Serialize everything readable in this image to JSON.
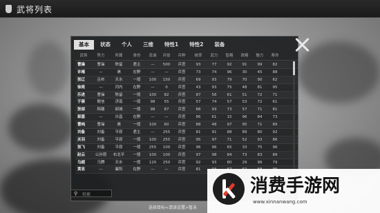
{
  "header": {
    "title": "武将列表"
  },
  "tabs": [
    {
      "label": "基本",
      "active": true
    },
    {
      "label": "状态"
    },
    {
      "label": "个人"
    },
    {
      "label": "三维"
    },
    {
      "label": "特性1"
    },
    {
      "label": "特性2"
    },
    {
      "label": "装备"
    }
  ],
  "columns": [
    "武将",
    "势力",
    "所属",
    "身份",
    "忠诚",
    "兵役",
    "兵种",
    "统率",
    "武力",
    "智略",
    "政略",
    "魅力",
    "寿命"
  ],
  "rows": [
    [
      "曹操",
      "曹操",
      "陈留",
      "君主",
      "—",
      "500",
      "兵官",
      "93",
      "77",
      "92",
      "91",
      "99",
      "82"
    ],
    [
      "许褚",
      "—",
      "谯",
      "在野",
      "—",
      "—",
      "兵官",
      "73",
      "74",
      "96",
      "30",
      "45",
      "88"
    ],
    [
      "张辽",
      "吕布",
      "天水",
      "一般",
      "100",
      "150",
      "兵官",
      "69",
      "93",
      "79",
      "70",
      "90",
      "62"
    ],
    [
      "徐晃",
      "—",
      "河内",
      "在野",
      "—",
      "0",
      "兵官",
      "43",
      "93",
      "75",
      "48",
      "81",
      "95"
    ],
    [
      "乐进",
      "曹操",
      "陈留",
      "一般",
      "100",
      "82",
      "兵官",
      "87",
      "56",
      "61",
      "51",
      "72",
      "71"
    ],
    [
      "于禁",
      "鲍信",
      "济南",
      "一般",
      "98",
      "55",
      "兵官",
      "57",
      "74",
      "57",
      "53",
      "72",
      "61"
    ],
    [
      "张郃",
      "韩馥",
      "邺城",
      "一般",
      "98",
      "87",
      "兵官",
      "88",
      "93",
      "73",
      "57",
      "71",
      "81"
    ],
    [
      "郭嘉",
      "—",
      "许昌",
      "在野",
      "—",
      "—",
      "兵官",
      "86",
      "61",
      "15",
      "96",
      "84",
      "73"
    ],
    [
      "曹纯",
      "曹操",
      "谯",
      "一般",
      "100",
      "60",
      "兵官",
      "88",
      "48",
      "97",
      "95",
      "71",
      "89"
    ],
    [
      "刘备",
      "刘备",
      "平原",
      "君主",
      "—",
      "255",
      "兵官",
      "81",
      "91",
      "88",
      "89",
      "80",
      "92"
    ],
    [
      "关羽",
      "刘备",
      "平原",
      "一般",
      "100",
      "255",
      "兵官",
      "95",
      "97",
      "71",
      "52",
      "93",
      "86"
    ],
    [
      "张飞",
      "刘备",
      "平原",
      "一般",
      "255",
      "100",
      "兵官",
      "96",
      "96",
      "65",
      "33",
      "75",
      "96"
    ],
    [
      "赵云",
      "公孙瓒",
      "右北平",
      "一般",
      "100",
      "100",
      "兵官",
      "97",
      "98",
      "84",
      "73",
      "83",
      "89"
    ],
    [
      "马超",
      "马腾",
      "天水",
      "一般",
      "120",
      "250",
      "兵官",
      "92",
      "93",
      "80",
      "29",
      "96",
      "79"
    ],
    [
      "黄忠",
      "—",
      "襄阳",
      "在野",
      "—",
      "—",
      "兵官",
      "81",
      "93",
      "67",
      "52",
      "68",
      "99"
    ]
  ],
  "search": {
    "placeholder": "检索"
  },
  "footer": {
    "hint": "选择目标<请读设置>暂未"
  },
  "watermark": {
    "text": "消费手游网",
    "url_prefix": "www",
    "url_main": "xinnanwang",
    "url_suffix": "com"
  }
}
